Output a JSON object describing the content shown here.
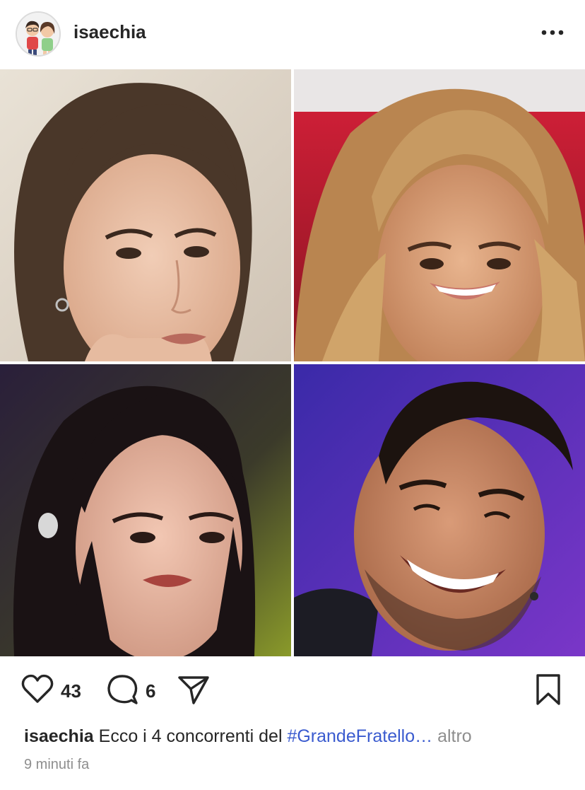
{
  "post": {
    "username": "isaechia",
    "likes": "43",
    "comments": "6",
    "caption_user": "isaechia",
    "caption_text": "Ecco i 4 concorrenti del",
    "caption_hashtag": "#GrandeFratello…",
    "caption_more": "altro",
    "timestamp": "9 minuti fa"
  },
  "icons": {
    "more": "more-options-icon",
    "like": "heart-icon",
    "comment": "comment-bubble-icon",
    "share": "send-paper-plane-icon",
    "save": "bookmark-icon"
  },
  "colors": {
    "text": "#262626",
    "hashtag": "#3a5bcf",
    "muted": "#8e8e8e"
  }
}
